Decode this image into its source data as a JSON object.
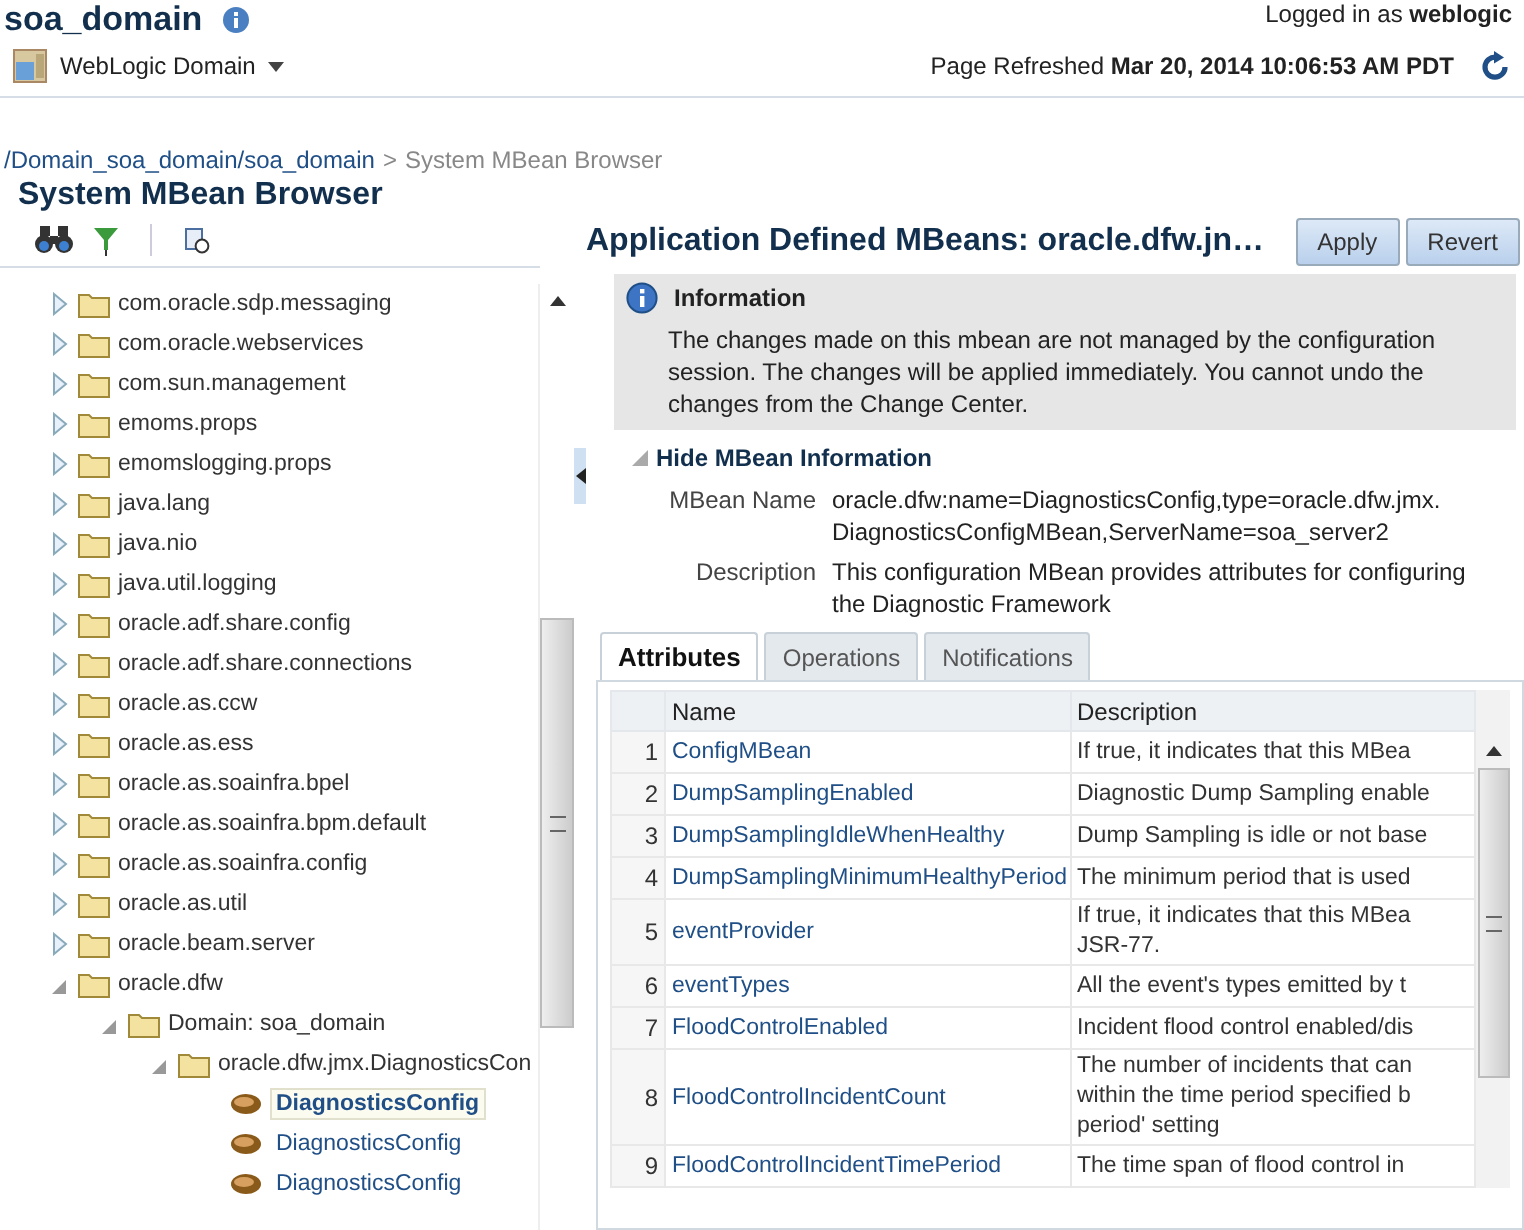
{
  "header": {
    "domain_title": "soa_domain",
    "menu_label": "WebLogic Domain",
    "logged_in_label": "Logged in as",
    "user": "weblogic",
    "refreshed_label": "Page Refreshed",
    "refreshed_time": "Mar 20, 2014 10:06:53 AM PDT"
  },
  "breadcrumb": {
    "path": "/Domain_soa_domain/soa_domain",
    "separator": ">",
    "current": "System MBean Browser"
  },
  "sidebar": {
    "title": "System MBean Browser",
    "tree": [
      {
        "label": "com.oracle.sdp.messaging",
        "kind": "folder",
        "expanded": false
      },
      {
        "label": "com.oracle.webservices",
        "kind": "folder",
        "expanded": false
      },
      {
        "label": "com.sun.management",
        "kind": "folder",
        "expanded": false
      },
      {
        "label": "emoms.props",
        "kind": "folder",
        "expanded": false
      },
      {
        "label": "emomslogging.props",
        "kind": "folder",
        "expanded": false
      },
      {
        "label": "java.lang",
        "kind": "folder",
        "expanded": false
      },
      {
        "label": "java.nio",
        "kind": "folder",
        "expanded": false
      },
      {
        "label": "java.util.logging",
        "kind": "folder",
        "expanded": false
      },
      {
        "label": "oracle.adf.share.config",
        "kind": "folder",
        "expanded": false
      },
      {
        "label": "oracle.adf.share.connections",
        "kind": "folder",
        "expanded": false
      },
      {
        "label": "oracle.as.ccw",
        "kind": "folder",
        "expanded": false
      },
      {
        "label": "oracle.as.ess",
        "kind": "folder",
        "expanded": false
      },
      {
        "label": "oracle.as.soainfra.bpel",
        "kind": "folder",
        "expanded": false
      },
      {
        "label": "oracle.as.soainfra.bpm.default",
        "kind": "folder",
        "expanded": false
      },
      {
        "label": "oracle.as.soainfra.config",
        "kind": "folder",
        "expanded": false
      },
      {
        "label": "oracle.as.util",
        "kind": "folder",
        "expanded": false
      },
      {
        "label": "oracle.beam.server",
        "kind": "folder",
        "expanded": false
      },
      {
        "label": "oracle.dfw",
        "kind": "folder",
        "expanded": true,
        "children": [
          {
            "label": "Domain: soa_domain",
            "kind": "folder",
            "expanded": true,
            "children": [
              {
                "label": "oracle.dfw.jmx.DiagnosticsCon",
                "kind": "folder",
                "expanded": true,
                "children": [
                  {
                    "label": "DiagnosticsConfig",
                    "kind": "bean",
                    "selected": true
                  },
                  {
                    "label": "DiagnosticsConfig",
                    "kind": "bean",
                    "selected": false
                  },
                  {
                    "label": "DiagnosticsConfig",
                    "kind": "bean",
                    "selected": false
                  }
                ]
              }
            ]
          }
        ]
      }
    ]
  },
  "main": {
    "title": "Application Defined MBeans: oracle.dfw.jn…",
    "buttons": [
      "Apply",
      "Revert"
    ],
    "info": {
      "title": "Information",
      "text": "The changes made on this mbean are not managed by the configuration session. The changes will be applied immediately. You cannot undo the changes from the Change Center."
    },
    "mbean_info": {
      "toggle": "Hide MBean Information",
      "fields": [
        {
          "label": "MBean Name",
          "value": "oracle.dfw:name=DiagnosticsConfig,type=oracle.dfw.jmx.\nDiagnosticsConfigMBean,ServerName=soa_server2"
        },
        {
          "label": "Description",
          "value": "This configuration MBean provides attributes for configuring\nthe Diagnostic Framework"
        }
      ]
    },
    "tabs": [
      {
        "label": "Attributes",
        "selected": true
      },
      {
        "label": "Operations",
        "selected": false
      },
      {
        "label": "Notifications",
        "selected": false
      }
    ],
    "table": {
      "columns": [
        "Name",
        "Description"
      ],
      "rows": [
        {
          "num": "1",
          "name": "ConfigMBean",
          "description": "If true, it indicates that this MBea"
        },
        {
          "num": "2",
          "name": "DumpSamplingEnabled",
          "description": "Diagnostic Dump Sampling enable"
        },
        {
          "num": "3",
          "name": "DumpSamplingIdleWhenHealthy",
          "description": "Dump Sampling is idle or not base"
        },
        {
          "num": "4",
          "name": "DumpSamplingMinimumHealthyPeriod",
          "description": "The minimum period that is used"
        },
        {
          "num": "5",
          "name": "eventProvider",
          "description": "If true, it indicates that this MBea\nJSR-77."
        },
        {
          "num": "6",
          "name": "eventTypes",
          "description": "All the event's types emitted by t"
        },
        {
          "num": "7",
          "name": "FloodControlEnabled",
          "description": "Incident flood control enabled/dis"
        },
        {
          "num": "8",
          "name": "FloodControlIncidentCount",
          "description": "The number of incidents that can\nwithin the time period specified b\nperiod' setting"
        },
        {
          "num": "9",
          "name": "FloodControlIncidentTimePeriod",
          "description": "The time span of flood control in"
        }
      ]
    }
  }
}
